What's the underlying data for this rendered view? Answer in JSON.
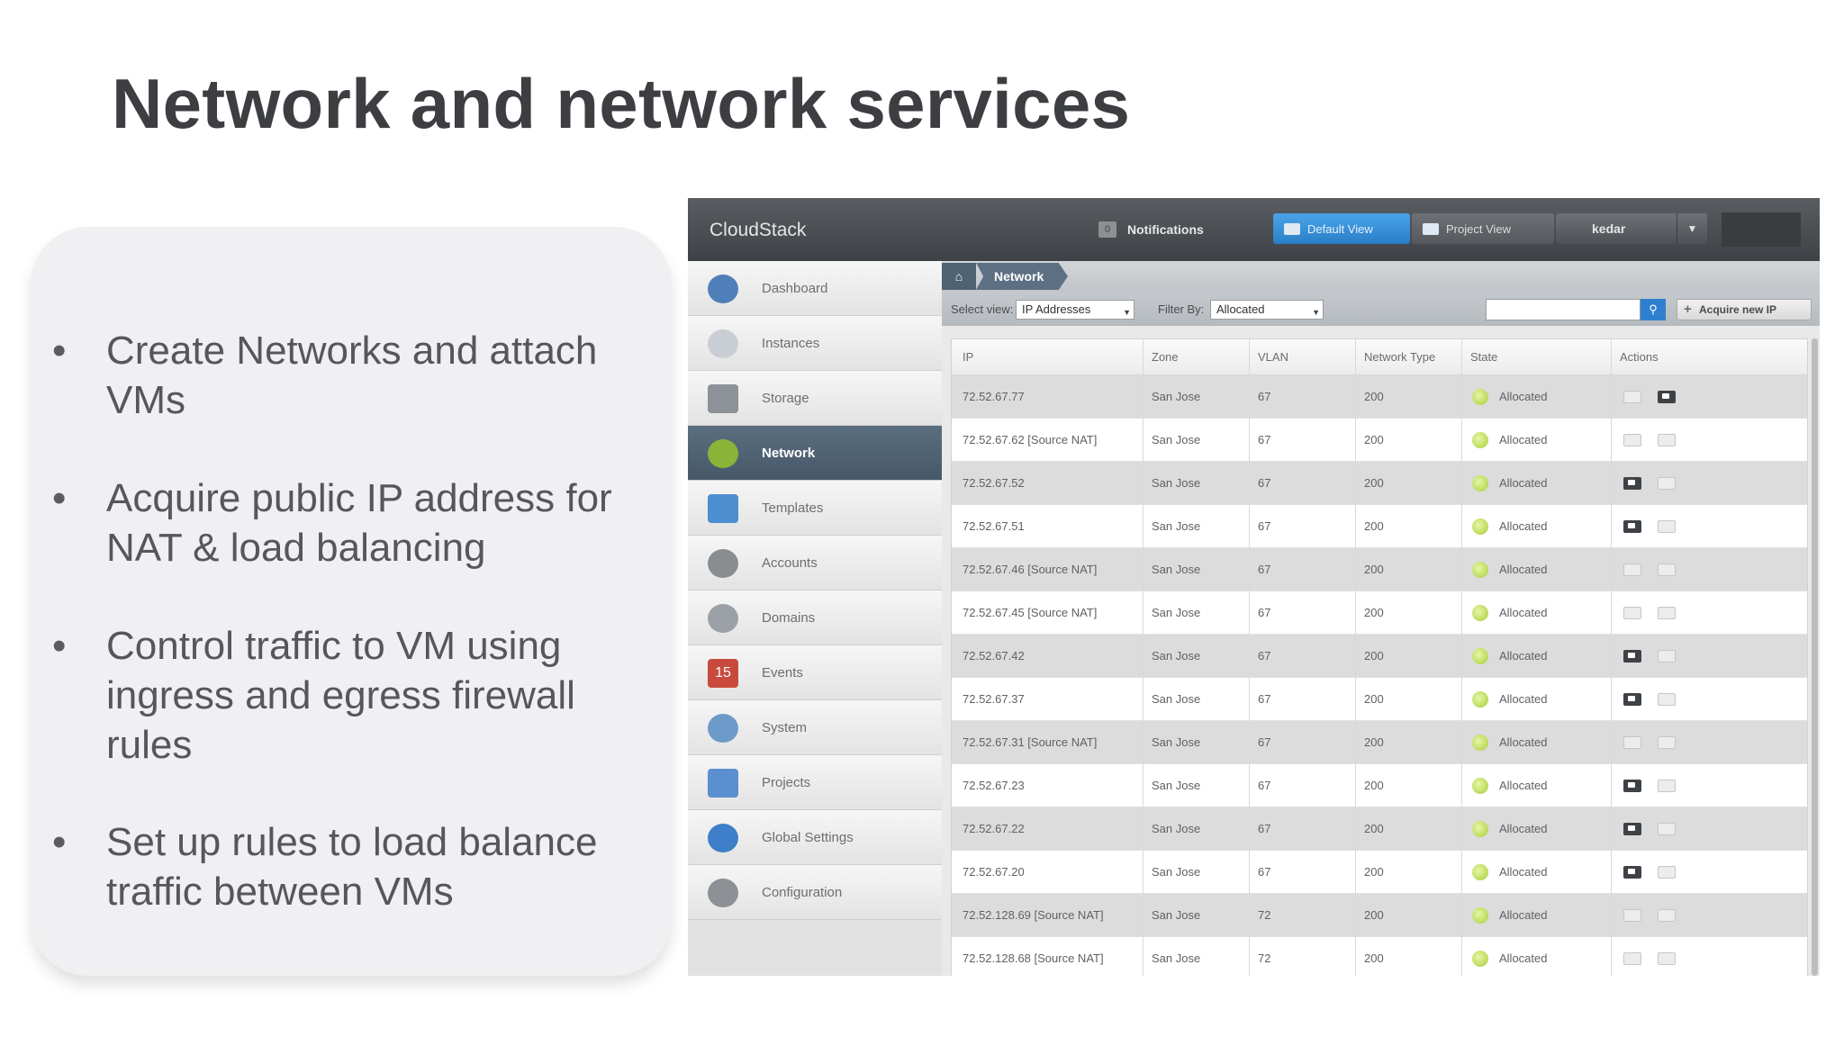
{
  "slide": {
    "title": "Network and network services",
    "bullets": [
      "Create Networks and attach VMs",
      "Acquire public IP address for NAT & load balancing",
      "Control traffic to VM using ingress and egress firewall rules",
      "Set up rules to load balance traffic between VMs"
    ]
  },
  "app": {
    "logo": "CloudStack",
    "notifications_label": "Notifications",
    "notifications_count": "0",
    "default_view_label": "Default View",
    "project_view_label": "Project View",
    "user_name": "kedar"
  },
  "sidebar": {
    "items": [
      {
        "label": "Dashboard",
        "icon": "dashboard-icon"
      },
      {
        "label": "Instances",
        "icon": "cloud-icon"
      },
      {
        "label": "Storage",
        "icon": "storage-icon"
      },
      {
        "label": "Network",
        "icon": "network-icon",
        "active": true
      },
      {
        "label": "Templates",
        "icon": "template-icon"
      },
      {
        "label": "Accounts",
        "icon": "user-icon"
      },
      {
        "label": "Domains",
        "icon": "domain-icon"
      },
      {
        "label": "Events",
        "icon": "calendar-icon",
        "icon_text": "15"
      },
      {
        "label": "System",
        "icon": "system-icon"
      },
      {
        "label": "Projects",
        "icon": "folder-icon"
      },
      {
        "label": "Global Settings",
        "icon": "globe-icon"
      },
      {
        "label": "Configuration",
        "icon": "gear-icon"
      }
    ]
  },
  "breadcrumb": {
    "current": "Network"
  },
  "filters": {
    "select_view_label": "Select view:",
    "select_view_value": "IP Addresses",
    "filter_by_label": "Filter By:",
    "filter_by_value": "Allocated",
    "acquire_label": "Acquire new IP"
  },
  "table": {
    "columns": [
      "IP",
      "Zone",
      "VLAN",
      "Network Type",
      "State",
      "Actions"
    ],
    "rows": [
      {
        "ip": "72.52.67.77",
        "zone": "San Jose",
        "vlan": "67",
        "type": "200",
        "state": "Allocated",
        "actions": [
          false,
          true
        ]
      },
      {
        "ip": "72.52.67.62 [Source NAT]",
        "zone": "San Jose",
        "vlan": "67",
        "type": "200",
        "state": "Allocated",
        "actions": [
          false,
          false
        ]
      },
      {
        "ip": "72.52.67.52",
        "zone": "San Jose",
        "vlan": "67",
        "type": "200",
        "state": "Allocated",
        "actions": [
          true,
          false
        ]
      },
      {
        "ip": "72.52.67.51",
        "zone": "San Jose",
        "vlan": "67",
        "type": "200",
        "state": "Allocated",
        "actions": [
          true,
          false
        ]
      },
      {
        "ip": "72.52.67.46 [Source NAT]",
        "zone": "San Jose",
        "vlan": "67",
        "type": "200",
        "state": "Allocated",
        "actions": [
          false,
          false
        ]
      },
      {
        "ip": "72.52.67.45 [Source NAT]",
        "zone": "San Jose",
        "vlan": "67",
        "type": "200",
        "state": "Allocated",
        "actions": [
          false,
          false
        ]
      },
      {
        "ip": "72.52.67.42",
        "zone": "San Jose",
        "vlan": "67",
        "type": "200",
        "state": "Allocated",
        "actions": [
          true,
          false
        ]
      },
      {
        "ip": "72.52.67.37",
        "zone": "San Jose",
        "vlan": "67",
        "type": "200",
        "state": "Allocated",
        "actions": [
          true,
          false
        ]
      },
      {
        "ip": "72.52.67.31 [Source NAT]",
        "zone": "San Jose",
        "vlan": "67",
        "type": "200",
        "state": "Allocated",
        "actions": [
          false,
          false
        ]
      },
      {
        "ip": "72.52.67.23",
        "zone": "San Jose",
        "vlan": "67",
        "type": "200",
        "state": "Allocated",
        "actions": [
          true,
          false
        ]
      },
      {
        "ip": "72.52.67.22",
        "zone": "San Jose",
        "vlan": "67",
        "type": "200",
        "state": "Allocated",
        "actions": [
          true,
          false
        ]
      },
      {
        "ip": "72.52.67.20",
        "zone": "San Jose",
        "vlan": "67",
        "type": "200",
        "state": "Allocated",
        "actions": [
          true,
          false
        ]
      },
      {
        "ip": "72.52.128.69 [Source NAT]",
        "zone": "San Jose",
        "vlan": "72",
        "type": "200",
        "state": "Allocated",
        "actions": [
          false,
          false
        ]
      },
      {
        "ip": "72.52.128.68 [Source NAT]",
        "zone": "San Jose",
        "vlan": "72",
        "type": "200",
        "state": "Allocated",
        "actions": [
          false,
          false
        ]
      }
    ]
  }
}
